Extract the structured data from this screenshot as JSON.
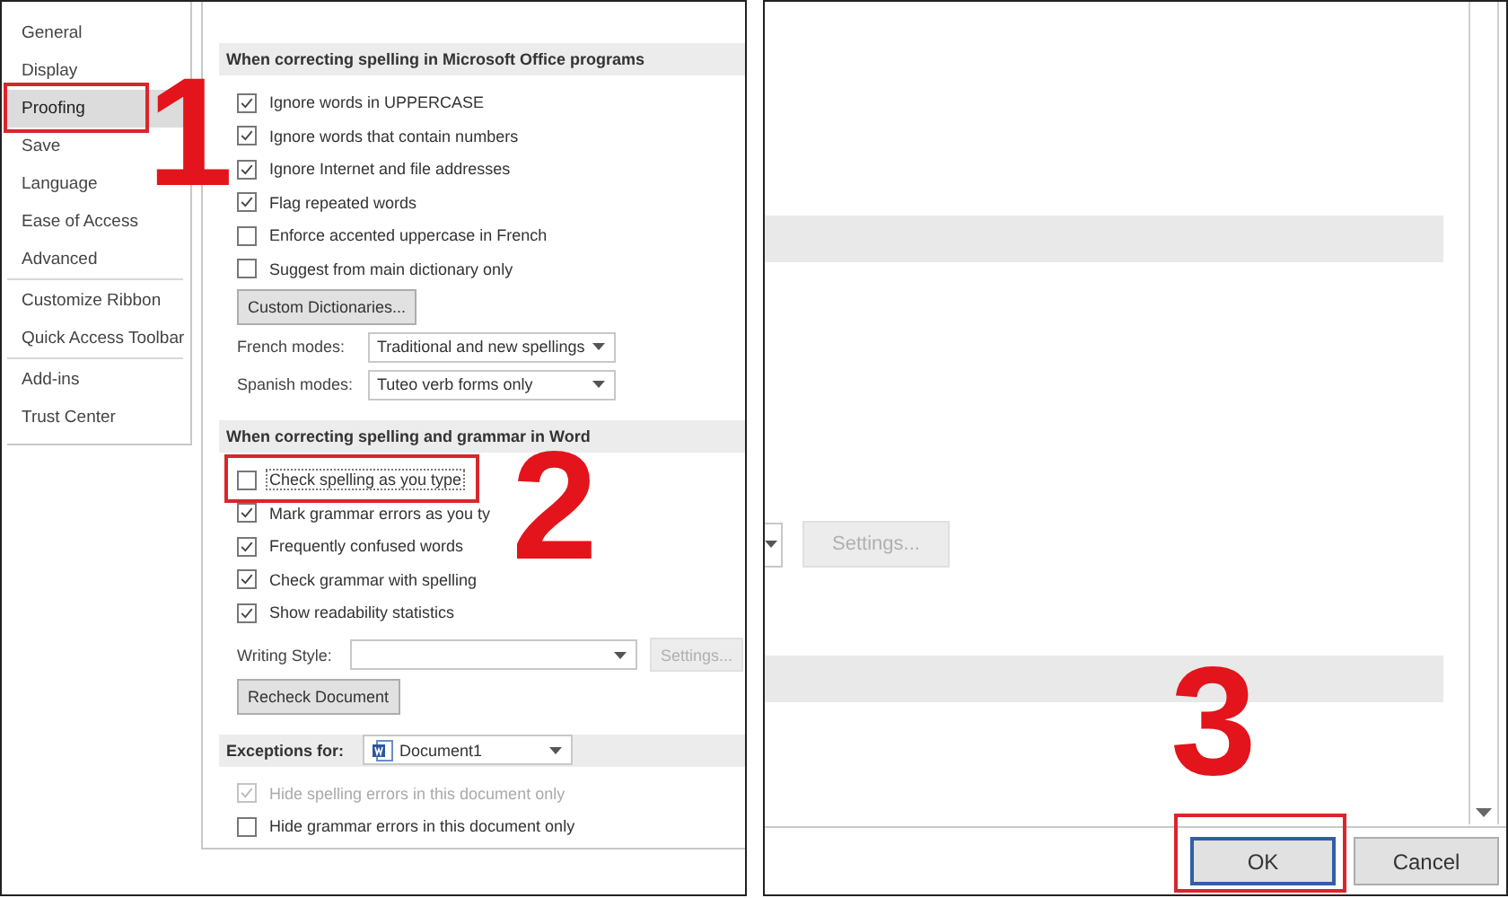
{
  "left_panel": {
    "sidebar": {
      "items": [
        {
          "label": "General",
          "selected": false,
          "divider_after": false,
          "highlight_box": false
        },
        {
          "label": "Display",
          "selected": false,
          "divider_after": false,
          "highlight_box": false
        },
        {
          "label": "Proofing",
          "selected": true,
          "divider_after": false,
          "highlight_box": true
        },
        {
          "label": "Save",
          "selected": false,
          "divider_after": false,
          "highlight_box": false
        },
        {
          "label": "Language",
          "selected": false,
          "divider_after": false,
          "highlight_box": false
        },
        {
          "label": "Ease of Access",
          "selected": false,
          "divider_after": false,
          "highlight_box": false
        },
        {
          "label": "Advanced",
          "selected": false,
          "divider_after": true,
          "highlight_box": false
        },
        {
          "label": "Customize Ribbon",
          "selected": false,
          "divider_after": false,
          "highlight_box": false
        },
        {
          "label": "Quick Access Toolbar",
          "selected": false,
          "divider_after": true,
          "highlight_box": false
        },
        {
          "label": "Add-ins",
          "selected": false,
          "divider_after": false,
          "highlight_box": false
        },
        {
          "label": "Trust Center",
          "selected": false,
          "divider_after": false,
          "highlight_box": false
        }
      ]
    },
    "rows": [
      {
        "kind": "header",
        "label": "When correcting spelling in Microsoft Office programs"
      },
      {
        "kind": "checkbox",
        "label": "Ignore words in UPPERCASE",
        "checked": true,
        "disabled": false,
        "focused": false,
        "highlight_box": false
      },
      {
        "kind": "checkbox",
        "label": "Ignore words that contain numbers",
        "checked": true,
        "disabled": false,
        "focused": false,
        "highlight_box": false
      },
      {
        "kind": "checkbox",
        "label": "Ignore Internet and file addresses",
        "checked": true,
        "disabled": false,
        "focused": false,
        "highlight_box": false
      },
      {
        "kind": "checkbox",
        "label": "Flag repeated words",
        "checked": true,
        "disabled": false,
        "focused": false,
        "highlight_box": false
      },
      {
        "kind": "checkbox",
        "label": "Enforce accented uppercase in French",
        "checked": false,
        "disabled": false,
        "focused": false,
        "highlight_box": false
      },
      {
        "kind": "checkbox",
        "label": "Suggest from main dictionary only",
        "checked": false,
        "disabled": false,
        "focused": false,
        "highlight_box": false
      },
      {
        "kind": "button",
        "label": "Custom Dictionaries..."
      },
      {
        "kind": "select",
        "label": "French modes:",
        "value": "Traditional and new spellings"
      },
      {
        "kind": "select",
        "label": "Spanish modes:",
        "value": "Tuteo verb forms only"
      },
      {
        "kind": "header",
        "label": "When correcting spelling and grammar in Word"
      },
      {
        "kind": "checkbox",
        "label": "Check spelling as you type",
        "checked": false,
        "disabled": false,
        "focused": true,
        "highlight_box": true
      },
      {
        "kind": "checkbox",
        "label": "Mark grammar errors as you ty",
        "checked": true,
        "disabled": false,
        "focused": false,
        "highlight_box": false
      },
      {
        "kind": "checkbox",
        "label": "Frequently confused words",
        "checked": true,
        "disabled": false,
        "focused": false,
        "highlight_box": false
      },
      {
        "kind": "checkbox",
        "label": "Check grammar with spelling",
        "checked": true,
        "disabled": false,
        "focused": false,
        "highlight_box": false
      },
      {
        "kind": "checkbox",
        "label": "Show readability statistics",
        "checked": true,
        "disabled": false,
        "focused": false,
        "highlight_box": false
      },
      {
        "kind": "style_select",
        "label": "Writing Style:",
        "button": {
          "label": "Settings...",
          "disabled": true
        }
      },
      {
        "kind": "button",
        "label": "Recheck Document"
      },
      {
        "kind": "exceptions",
        "label": "Exceptions for:",
        "value": "Document1"
      },
      {
        "kind": "checkbox",
        "label": "Hide spelling errors in this document only",
        "checked": true,
        "disabled": true,
        "focused": false,
        "highlight_box": false
      },
      {
        "kind": "checkbox",
        "label": "Hide grammar errors in this document only",
        "checked": false,
        "disabled": false,
        "focused": false,
        "highlight_box": false
      }
    ]
  },
  "right_panel": {
    "settings_button": {
      "label": "Settings...",
      "disabled": true
    },
    "buttons": [
      {
        "label": "OK",
        "default": true,
        "highlight_box": true
      },
      {
        "label": "Cancel",
        "default": false,
        "highlight_box": false
      }
    ]
  },
  "step_numbers": [
    "1",
    "2",
    "3"
  ]
}
